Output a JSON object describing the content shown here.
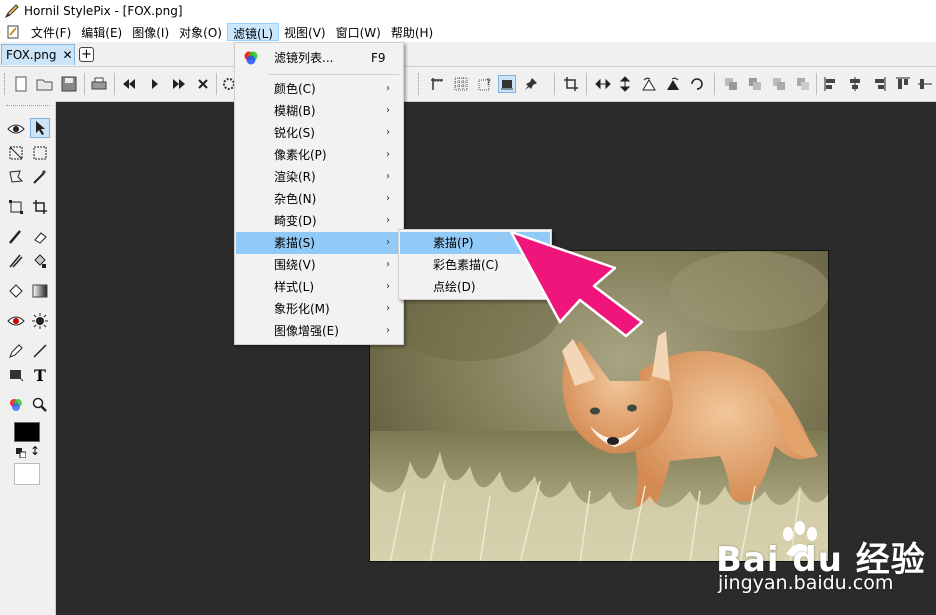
{
  "window": {
    "title": "Hornil StylePix - [FOX.png]"
  },
  "menubar": {
    "items": [
      {
        "label": "文件(F)"
      },
      {
        "label": "编辑(E)"
      },
      {
        "label": "图像(I)"
      },
      {
        "label": "对象(O)"
      },
      {
        "label": "滤镜(L)",
        "active": true
      },
      {
        "label": "视图(V)"
      },
      {
        "label": "窗口(W)"
      },
      {
        "label": "帮助(H)"
      }
    ]
  },
  "tabs": [
    {
      "label": "FOX.png",
      "close": "✕"
    }
  ],
  "tab_add": "+",
  "filter_menu": {
    "items": [
      {
        "label": "滤镜列表...",
        "shortcut": "F9"
      },
      {
        "label": "颜色(C)",
        "submenu": true
      },
      {
        "label": "模糊(B)",
        "submenu": true
      },
      {
        "label": "锐化(S)",
        "submenu": true
      },
      {
        "label": "像素化(P)",
        "submenu": true
      },
      {
        "label": "渲染(R)",
        "submenu": true
      },
      {
        "label": "杂色(N)",
        "submenu": true
      },
      {
        "label": "畸变(D)",
        "submenu": true
      },
      {
        "label": "素描(S)",
        "submenu": true,
        "highlight": true
      },
      {
        "label": "围绕(V)",
        "submenu": true
      },
      {
        "label": "样式(L)",
        "submenu": true
      },
      {
        "label": "象形化(M)",
        "submenu": true
      },
      {
        "label": "图像增强(E)",
        "submenu": true
      }
    ],
    "arrow_glyph": "›"
  },
  "sketch_submenu": {
    "items": [
      {
        "label": "素描(P)",
        "highlight": true
      },
      {
        "label": "彩色素描(C)"
      },
      {
        "label": "点绘(D)"
      }
    ]
  },
  "toolbox": {
    "text_tool_glyph": "T",
    "swap_glyph": "↕",
    "foreground_color": "#000000",
    "background_color": "#ffffff"
  },
  "colors": {
    "menu_highlight": "#91c9f7",
    "tab_active": "#cce4f7",
    "canvas_bg": "#2b2b2b",
    "annotation_arrow": "#f0157a"
  },
  "watermark": {
    "brand": "Bai du 经验",
    "url": "jingyan.baidu.com"
  }
}
